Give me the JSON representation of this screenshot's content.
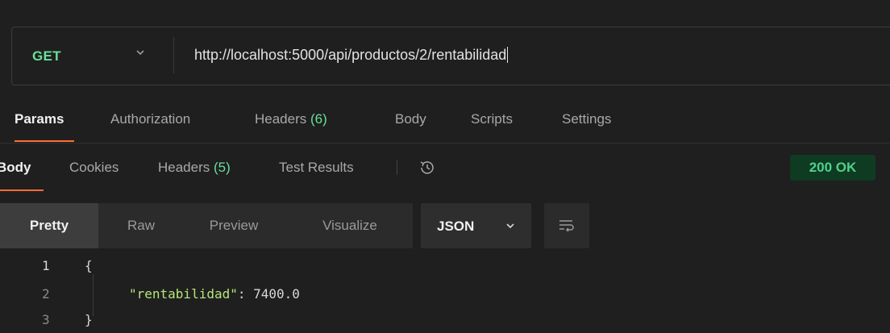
{
  "request": {
    "method": "GET",
    "url": "http://localhost:5000/api/productos/2/rentabilidad"
  },
  "request_tabs": [
    {
      "label": "Params",
      "active": true
    },
    {
      "label": "Authorization"
    },
    {
      "label": "Headers",
      "count": "(6)"
    },
    {
      "label": "Body"
    },
    {
      "label": "Scripts"
    },
    {
      "label": "Settings"
    }
  ],
  "response_tabs": [
    {
      "label": "Body",
      "active": true
    },
    {
      "label": "Cookies"
    },
    {
      "label": "Headers",
      "count": "(5)"
    },
    {
      "label": "Test Results"
    }
  ],
  "status": {
    "text": "200 OK",
    "color": "#4fd18b",
    "background": "#0e3b22"
  },
  "format_tabs": [
    {
      "label": "Pretty",
      "active": true
    },
    {
      "label": "Raw"
    },
    {
      "label": "Preview"
    },
    {
      "label": "Visualize"
    }
  ],
  "language": "JSON",
  "code": {
    "lines": [
      {
        "number": "1",
        "brace": "{"
      },
      {
        "number": "2",
        "key": "\"rentabilidad\"",
        "colon": ": ",
        "value": "7400.0"
      },
      {
        "number": "3",
        "brace": "}"
      }
    ]
  },
  "icons": {
    "method_caret": "chevron-down-icon",
    "history": "history-icon",
    "language_caret": "chevron-down-icon",
    "wrap": "wrap-lines-icon"
  },
  "colors": {
    "accent": "#ff6c37",
    "method": "#6bdd9a",
    "count": "#6bdd9a",
    "json_key": "#b6e57a"
  }
}
